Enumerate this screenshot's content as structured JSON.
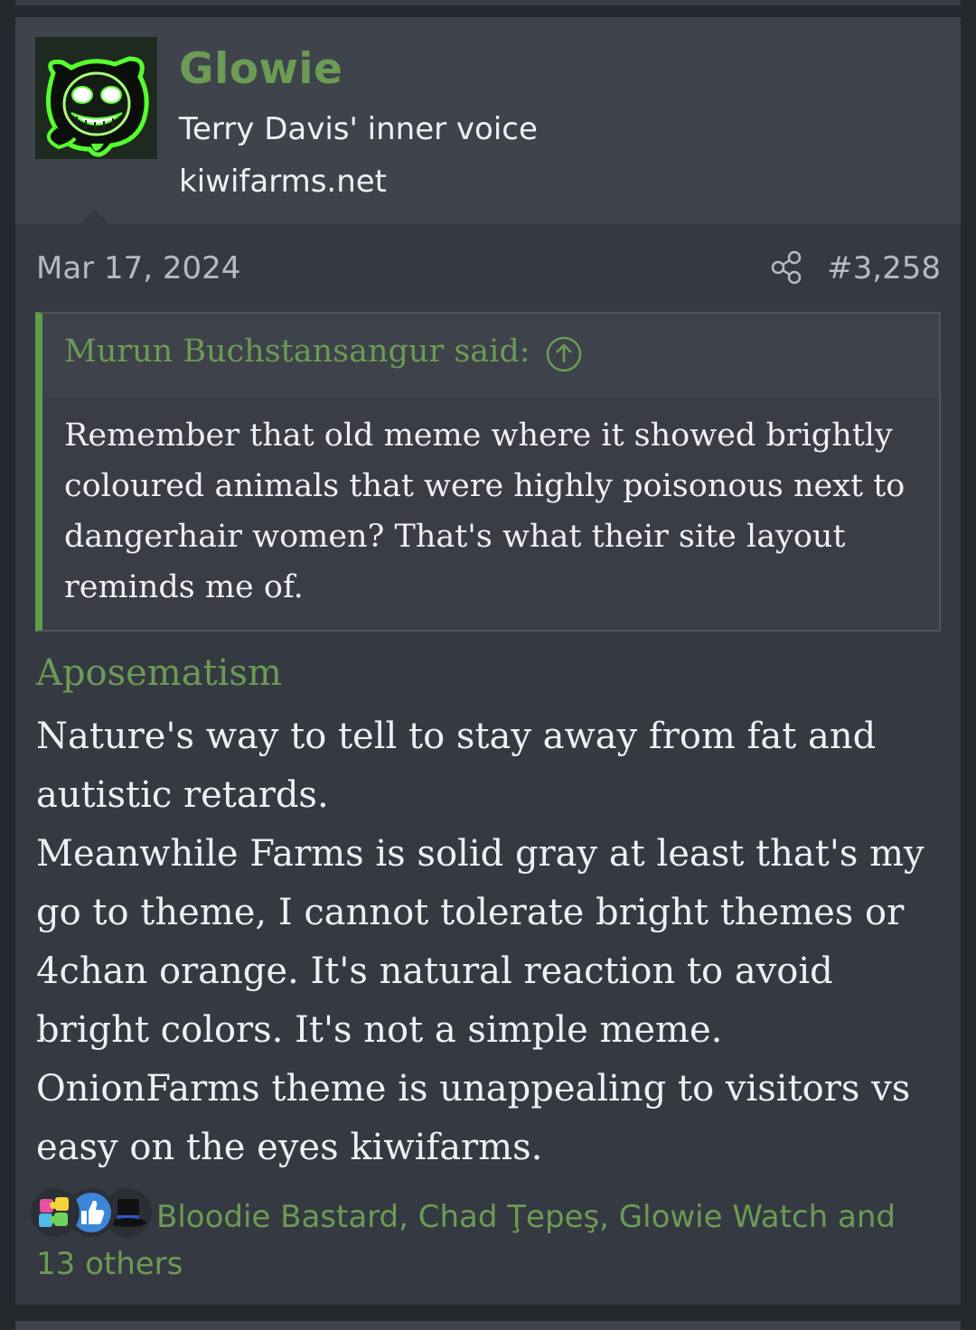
{
  "user": {
    "name": "Glowie",
    "title": "Terry Davis' inner voice",
    "site": "kiwifarms.net"
  },
  "post": {
    "date": "Mar 17, 2024",
    "number": "#3,258"
  },
  "quote": {
    "author_line": "Murun Buchstansangur said:",
    "text": "Remember that old meme where it showed brightly coloured animals that were highly poisonous next to dangerhair women? That's what their site layout reminds me of."
  },
  "content": {
    "heading": "Aposematism",
    "body": "Nature's way to tell to stay away from fat and autistic retards.\nMeanwhile Farms is solid gray at least that's my go to theme, I cannot tolerate bright themes or 4chan orange. It's natural reaction to avoid bright colors. It's not a simple meme. OnionFarms theme is unappealing to visitors vs easy on the eyes kiwifarms."
  },
  "reactions": {
    "icons": [
      "puzzle-icon",
      "thumbs-up-icon",
      "top-hat-icon"
    ],
    "summary": "Bloodie Bastard, Chad Ţepeş, Glowie Watch and 13 others"
  },
  "colors": {
    "accent": "#6b9b55",
    "page_background": "#25282d",
    "post_background": "#353941",
    "user_block_background": "#3f434b",
    "text": "#eef0f2",
    "muted_text": "#b7bbc1"
  }
}
